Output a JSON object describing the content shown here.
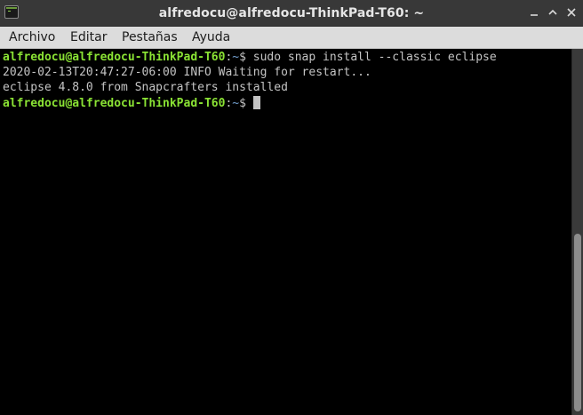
{
  "window": {
    "title": "alfredocu@alfredocu-ThinkPad-T60: ~"
  },
  "menu": {
    "items": [
      "Archivo",
      "Editar",
      "Pestañas",
      "Ayuda"
    ]
  },
  "terminal": {
    "lines": [
      {
        "user_host": "alfredocu@alfredocu-ThinkPad-T60",
        "sep": ":",
        "path": "~",
        "symbol": "$",
        "command": " sudo snap install --classic eclipse"
      },
      {
        "text": "2020-02-13T20:47:27-06:00 INFO Waiting for restart..."
      },
      {
        "text": "eclipse 4.8.0 from Snapcrafters installed"
      },
      {
        "user_host": "alfredocu@alfredocu-ThinkPad-T60",
        "sep": ":",
        "path": "~",
        "symbol": "$",
        "command": " "
      }
    ]
  },
  "colors": {
    "titlebar": "#383838",
    "menubar": "#dcdcdc",
    "terminal_bg": "#000000",
    "prompt_user": "#8ae234",
    "prompt_path": "#729fcf",
    "text": "#c4c4c4"
  },
  "icons": {
    "app": "terminal-icon",
    "minimize": "minimize-icon",
    "maximize": "maximize-icon",
    "close": "close-icon"
  }
}
